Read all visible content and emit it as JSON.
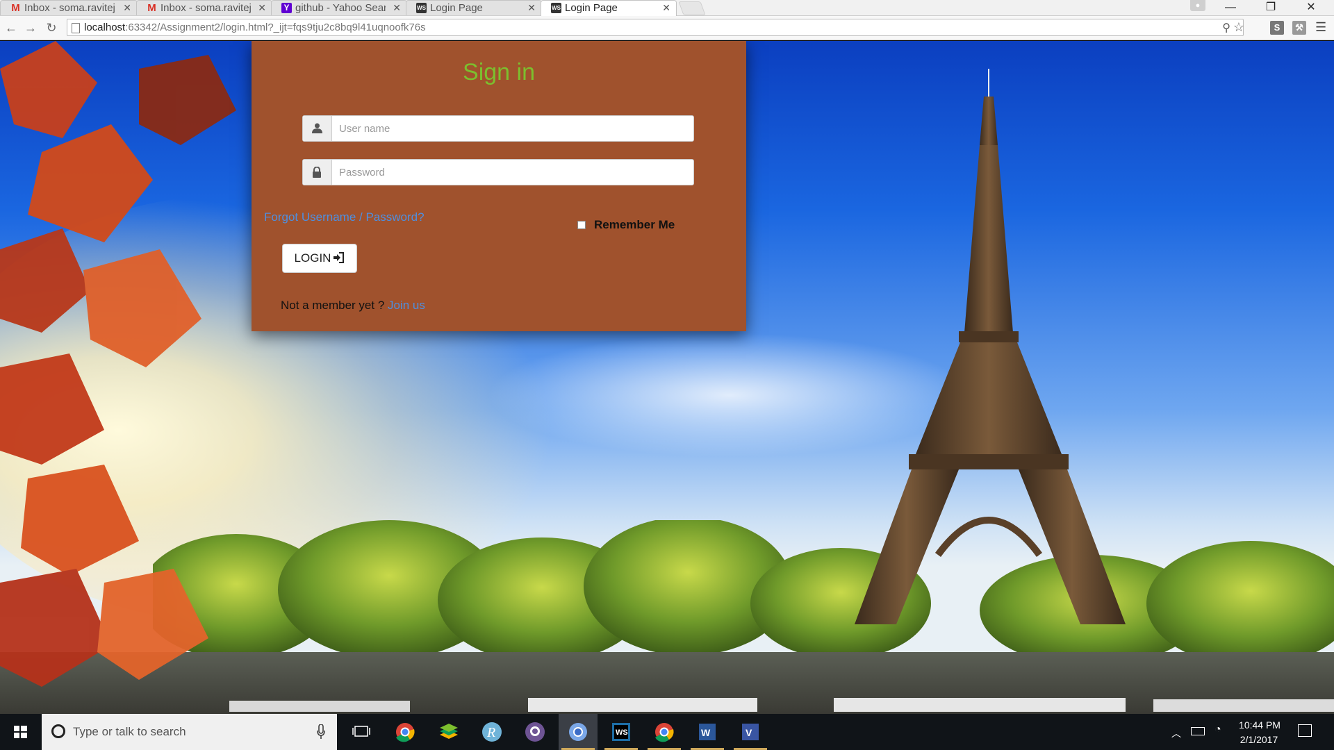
{
  "browser": {
    "tabs": [
      {
        "title": "Inbox - soma.ravitej",
        "icon": "gmail-icon",
        "active": false
      },
      {
        "title": "Inbox - soma.ravitej",
        "icon": "gmail-icon",
        "active": false
      },
      {
        "title": "github - Yahoo Searc",
        "icon": "yahoo-icon",
        "active": false
      },
      {
        "title": "Login Page",
        "icon": "webstorm-icon",
        "active": false
      },
      {
        "title": "Login Page",
        "icon": "webstorm-icon",
        "active": true
      }
    ],
    "url_host": "localhost",
    "url_path": ":63342/Assignment2/login.html?_ijt=fqs9tju2c8bq9l41uqnoofk76s"
  },
  "login": {
    "title": "Sign in",
    "username_placeholder": "User name",
    "password_placeholder": "Password",
    "forgot_link": "Forgot Username / Password?",
    "remember_label": "Remember Me",
    "login_button": "LOGIN",
    "member_prompt": "Not a member yet ? ",
    "join_link": "Join us"
  },
  "taskbar": {
    "search_placeholder": "Type or talk to search",
    "apps": [
      "task-view",
      "chrome",
      "stack",
      "r-studio",
      "github",
      "chromium",
      "webstorm",
      "chrome",
      "word",
      "visio"
    ],
    "time": "10:44 PM",
    "date": "2/1/2017"
  },
  "colors": {
    "card_background": "#a0522d",
    "title_green": "#7cbf2e",
    "link_blue": "#4e8fe0",
    "taskbar": "#101418"
  }
}
